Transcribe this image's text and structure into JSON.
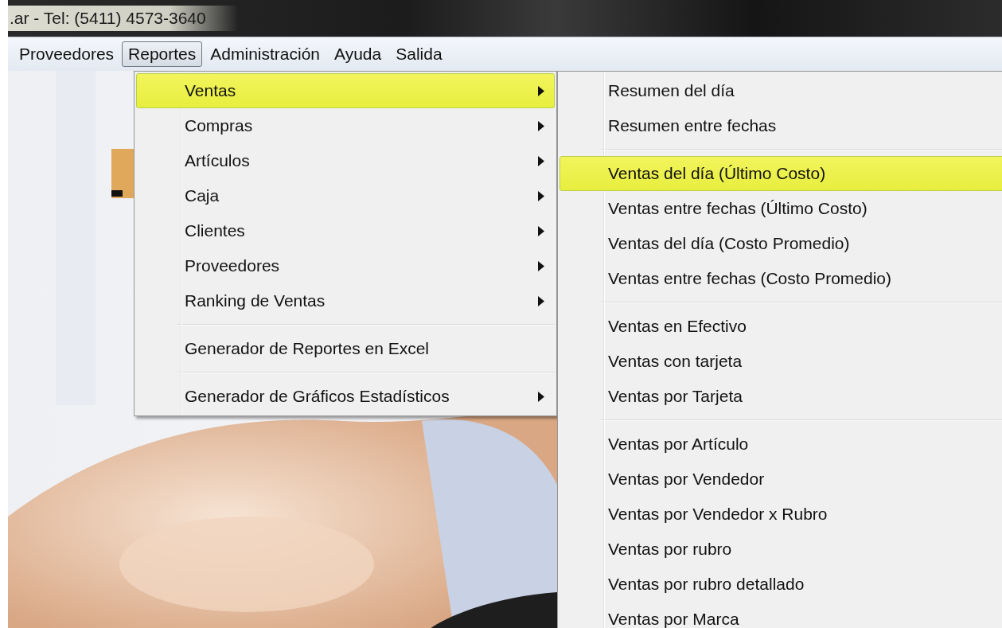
{
  "window": {
    "title": ".ar - Tel: (5411) 4573-3640"
  },
  "menu_bar": [
    {
      "label": "Proveedores",
      "selected": false
    },
    {
      "label": "Reportes",
      "selected": true
    },
    {
      "label": "Administración",
      "selected": false
    },
    {
      "label": "Ayuda",
      "selected": false
    },
    {
      "label": "Salida",
      "selected": false
    }
  ],
  "menu": [
    {
      "kind": "item",
      "label": "Ventas",
      "submenu": true,
      "selected": true
    },
    {
      "kind": "item",
      "label": "Compras",
      "submenu": true,
      "selected": false
    },
    {
      "kind": "item",
      "label": "Artículos",
      "submenu": true,
      "selected": false
    },
    {
      "kind": "item",
      "label": "Caja",
      "submenu": true,
      "selected": false
    },
    {
      "kind": "item",
      "label": "Clientes",
      "submenu": true,
      "selected": false
    },
    {
      "kind": "item",
      "label": "Proveedores",
      "submenu": true,
      "selected": false
    },
    {
      "kind": "item",
      "label": "Ranking de Ventas",
      "submenu": true,
      "selected": false
    },
    {
      "kind": "separator"
    },
    {
      "kind": "item",
      "label": "Generador de Reportes en Excel",
      "submenu": false,
      "selected": false
    },
    {
      "kind": "separator"
    },
    {
      "kind": "item",
      "label": "Generador de Gráficos Estadísticos",
      "submenu": true,
      "selected": false
    }
  ],
  "submenu": [
    {
      "kind": "item",
      "label": "Resumen del día",
      "selected": false
    },
    {
      "kind": "item",
      "label": "Resumen entre fechas",
      "selected": false
    },
    {
      "kind": "separator"
    },
    {
      "kind": "item",
      "label": "Ventas del día (Último Costo)",
      "selected": true
    },
    {
      "kind": "item",
      "label": "Ventas entre fechas (Último Costo)",
      "selected": false
    },
    {
      "kind": "item",
      "label": "Ventas del día (Costo Promedio)",
      "selected": false
    },
    {
      "kind": "item",
      "label": "Ventas entre fechas (Costo Promedio)",
      "selected": false
    },
    {
      "kind": "separator"
    },
    {
      "kind": "item",
      "label": "Ventas en Efectivo",
      "selected": false
    },
    {
      "kind": "item",
      "label": "Ventas con tarjeta",
      "selected": false
    },
    {
      "kind": "item",
      "label": "Ventas por Tarjeta",
      "selected": false
    },
    {
      "kind": "separator"
    },
    {
      "kind": "item",
      "label": "Ventas por Artículo",
      "selected": false
    },
    {
      "kind": "item",
      "label": "Ventas por Vendedor",
      "selected": false
    },
    {
      "kind": "item",
      "label": "Ventas por Vendedor x Rubro",
      "selected": false
    },
    {
      "kind": "item",
      "label": "Ventas por rubro",
      "selected": false
    },
    {
      "kind": "item",
      "label": "Ventas por rubro detallado",
      "selected": false
    },
    {
      "kind": "item",
      "label": "Ventas por Marca",
      "selected": false
    }
  ]
}
